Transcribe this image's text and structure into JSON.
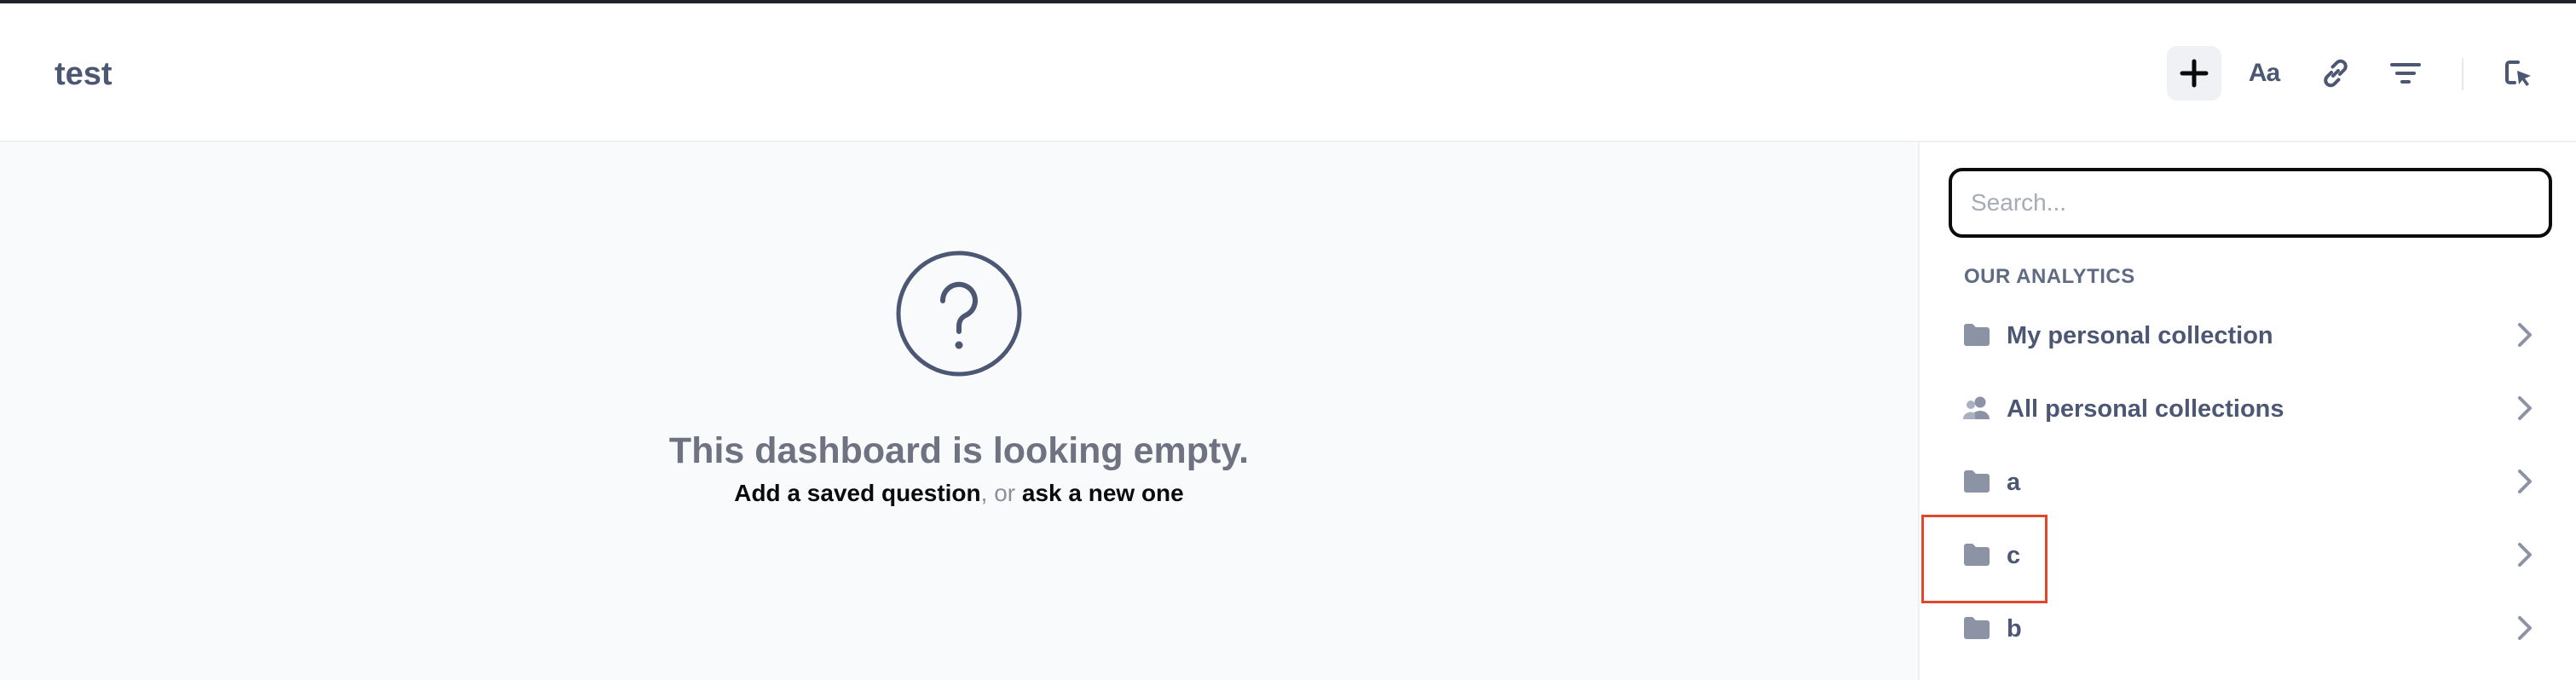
{
  "header": {
    "title": "test",
    "tools": [
      {
        "name": "add-question",
        "icon": "plus-icon"
      },
      {
        "name": "add-text",
        "icon": "text-aa-icon",
        "label": "Aa"
      },
      {
        "name": "add-link",
        "icon": "link-icon"
      },
      {
        "name": "add-filter",
        "icon": "filter-icon"
      },
      {
        "name": "add-action",
        "icon": "click-action-icon"
      }
    ]
  },
  "main": {
    "empty_title": "This dashboard is looking empty.",
    "add_saved_link": "Add a saved question",
    "or_text": ", or ",
    "ask_new_link": "ask a new one"
  },
  "sidebar": {
    "search_placeholder": "Search...",
    "section_label": "OUR ANALYTICS",
    "items": [
      {
        "label": "My personal collection",
        "icon": "folder-icon"
      },
      {
        "label": "All personal collections",
        "icon": "users-icon"
      },
      {
        "label": "a",
        "icon": "folder-icon"
      },
      {
        "label": "c",
        "icon": "folder-icon"
      },
      {
        "label": "b",
        "icon": "folder-icon"
      }
    ]
  },
  "colors": {
    "text": "#4c5773",
    "muted": "#8a8f99",
    "border_highlight": "#e0482b",
    "background": "#f9fafb"
  }
}
